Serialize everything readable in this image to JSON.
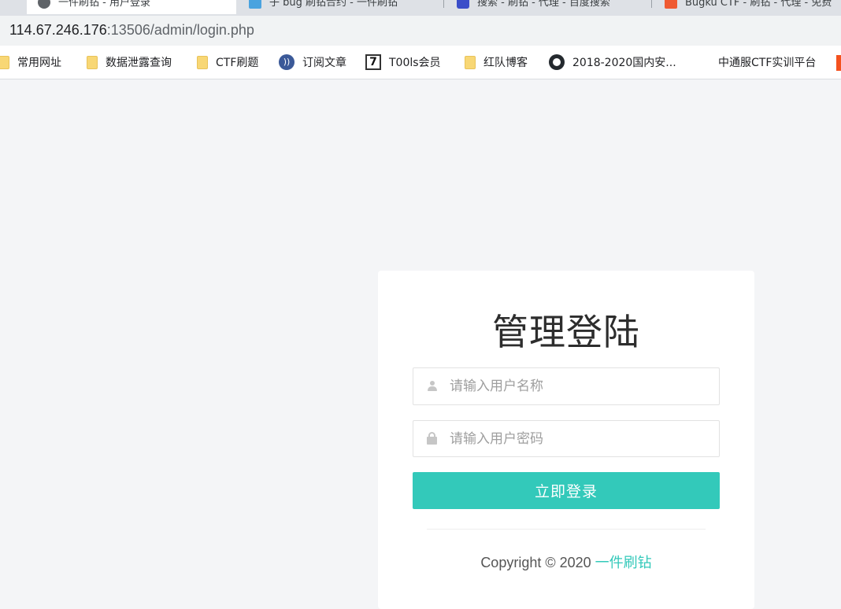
{
  "browser": {
    "tabs": [
      {
        "label": "一件刷钻 - 用户登录",
        "active": true,
        "icon": "globe-icon"
      },
      {
        "label": "子 bug 刷钻合约 - 一件刷钻",
        "active": false,
        "icon": "page-icon"
      },
      {
        "label": "搜索 - 刷钻 - 代理 - 百度搜索",
        "active": false,
        "icon": "baidu-icon"
      },
      {
        "label": "Bugku CTF - 刷钻 - 代理 - 免费",
        "active": false,
        "icon": "bugku-icon"
      }
    ],
    "address": {
      "host": "114.67.246.176",
      "rest": ":13506/admin/login.php"
    },
    "bookmarks": [
      {
        "label": "常用网址",
        "icon": "folder-icon"
      },
      {
        "label": "数据泄露查询",
        "icon": "folder-icon"
      },
      {
        "label": "CTF刷题",
        "icon": "folder-icon"
      },
      {
        "label": "订阅文章",
        "icon": "rss-icon"
      },
      {
        "label": "T00ls会员",
        "icon": "t00ls-icon"
      },
      {
        "label": "红队博客",
        "icon": "folder-icon"
      },
      {
        "label": "2018-2020国内安...",
        "icon": "github-icon"
      },
      {
        "label": "中通服CTF实训平台",
        "icon": "none"
      }
    ]
  },
  "login": {
    "title": "管理登陆",
    "username_placeholder": "请输入用户名称",
    "password_placeholder": "请输入用户密码",
    "submit_label": "立即登录",
    "copyright_prefix": "Copyright © 2020",
    "copyright_link": "一件刷钻"
  },
  "colors": {
    "accent": "#33c9ba",
    "page_bg": "#f4f5f7"
  }
}
